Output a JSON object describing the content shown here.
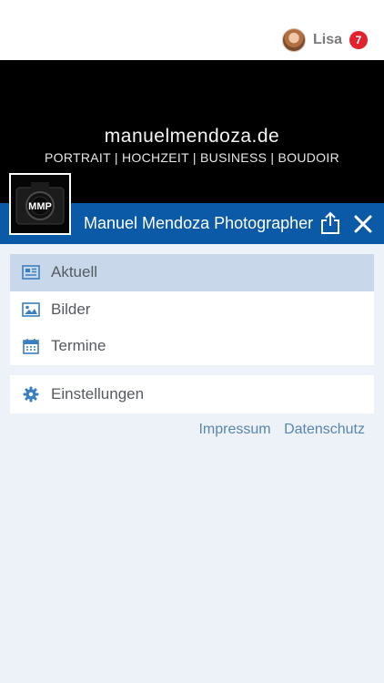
{
  "user": {
    "name": "Lisa",
    "notification_count": "7"
  },
  "cover": {
    "domain": "manuelmendoza.de",
    "tagline": "PORTRAIT | HOCHZEIT | BUSINESS | BOUDOIR"
  },
  "logo": {
    "text": "MMP"
  },
  "header": {
    "title": "Manuel Mendoza Photographer"
  },
  "menu": {
    "items": [
      {
        "label": "Aktuell",
        "icon": "newspaper-icon"
      },
      {
        "label": "Bilder",
        "icon": "image-icon"
      },
      {
        "label": "Termine",
        "icon": "calendar-icon"
      }
    ],
    "settings": {
      "label": "Einstellungen",
      "icon": "gear-icon"
    }
  },
  "footer": {
    "impressum": "Impressum",
    "datenschutz": "Datenschutz"
  },
  "colors": {
    "accent": "#0b5aa8",
    "active_item": "#c8d8ea",
    "badge": "#e0232c",
    "link": "#5a86ad",
    "icon": "#3c7fc0"
  }
}
